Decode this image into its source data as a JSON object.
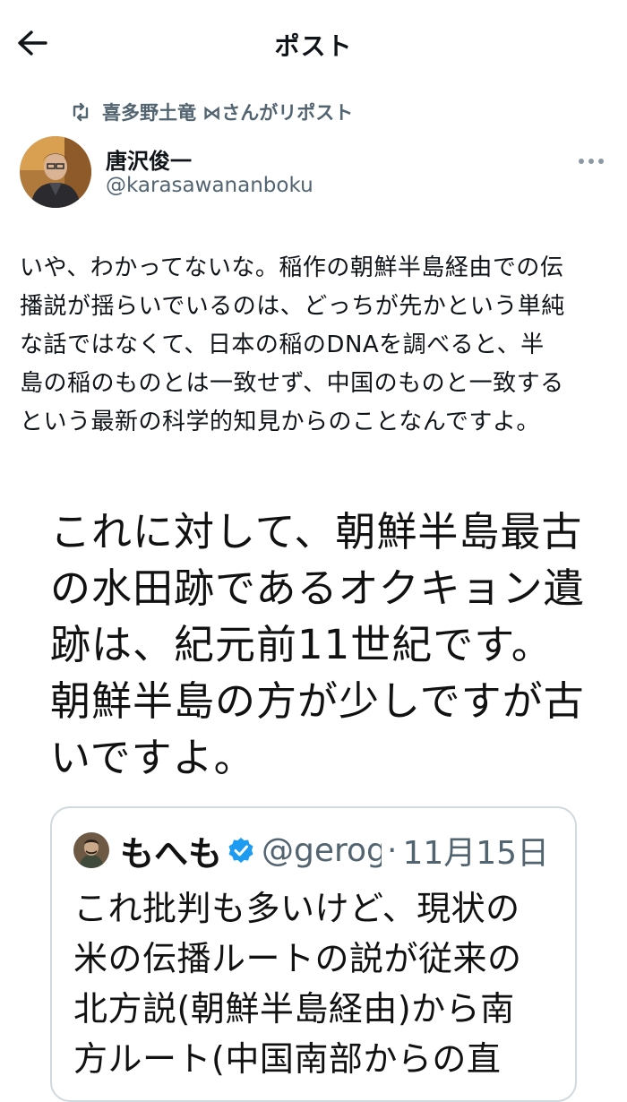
{
  "header": {
    "title": "ポスト",
    "back_icon": "arrow-left-icon"
  },
  "repost": {
    "icon": "repost-icon",
    "text": "喜多野土竜 ⋈さんがリポスト"
  },
  "author": {
    "name": "唐沢俊一",
    "handle": "@karasawananboku",
    "more_icon": "more-dots-icon"
  },
  "post": {
    "lines": [
      "いや、わかってないな。稲作の朝鮮半島経由での伝",
      "播説が揺らいでいるのは、どっちが先かという単純",
      "な話ではなくて、日本の稲のDNAを調べると、半",
      "島の稲のものとは一致せず、中国のものと一致する",
      "という最新の科学的知見からのことなんですよ。"
    ]
  },
  "image": {
    "lines": [
      "これに対して、朝鮮半島最古",
      "の水田跡であるオクキョン遺",
      "跡は、紀元前11世紀です。",
      "朝鮮半島の方が少しですが古",
      "いですよ。"
    ],
    "quote": {
      "name": "もへも",
      "verified_icon": "verified-badge-icon",
      "handle": "@gerog",
      "separator": "·",
      "date": "11月15日",
      "lines": [
        "これ批判も多いけど、現状の",
        "米の伝播ルートの説が従来の",
        "北方説(朝鮮半島経由)から南",
        "方ルート(中国南部からの直"
      ]
    }
  },
  "colors": {
    "text": "#0f1419",
    "secondary": "#536471",
    "border": "#cfd9de",
    "verified": "#1d9bf0"
  }
}
